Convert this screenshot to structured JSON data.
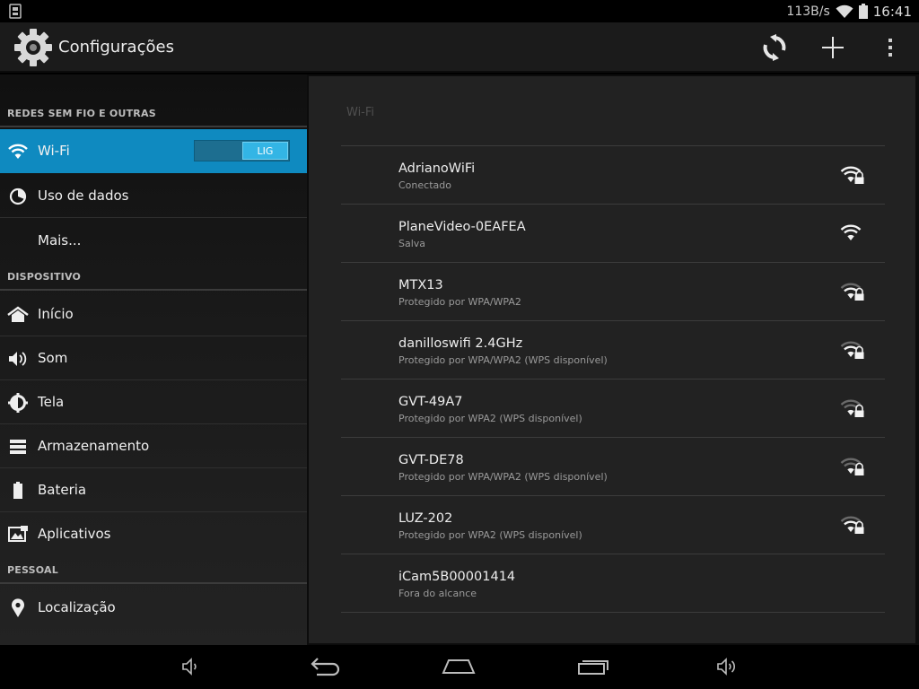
{
  "status_bar": {
    "speed": "113B/s",
    "time": "16:41"
  },
  "action_bar": {
    "title": "Configurações",
    "icons": [
      "gear-icon",
      "sync-icon",
      "add-icon",
      "overflow-menu-icon"
    ]
  },
  "sidebar": {
    "sections": [
      {
        "title": "REDES SEM FIO E OUTRAS"
      },
      {
        "title": "DISPOSITIVO"
      },
      {
        "title": "PESSOAL"
      }
    ],
    "items": [
      {
        "label": "Wi-Fi",
        "icon": "wifi-icon",
        "toggle": "LIG",
        "selected": true
      },
      {
        "label": "Uso de dados",
        "icon": "data-usage-icon"
      },
      {
        "label": "Mais...",
        "icon": ""
      },
      {
        "label": "Início",
        "icon": "home-icon"
      },
      {
        "label": "Som",
        "icon": "speaker-icon"
      },
      {
        "label": "Tela",
        "icon": "display-icon"
      },
      {
        "label": "Armazenamento",
        "icon": "storage-icon"
      },
      {
        "label": "Bateria",
        "icon": "battery-icon"
      },
      {
        "label": "Aplicativos",
        "icon": "apps-icon"
      },
      {
        "label": "Localização",
        "icon": "location-icon"
      }
    ]
  },
  "wifi_panel": {
    "title": "Wi-Fi",
    "networks": [
      {
        "name": "AdrianoWiFi",
        "status": "Conectado",
        "secured": true,
        "signal": "strong"
      },
      {
        "name": "PlaneVideo-0EAFEA",
        "status": "Salva",
        "secured": false,
        "signal": "strong"
      },
      {
        "name": "MTX13",
        "status": "Protegido por WPA/WPA2",
        "secured": true,
        "signal": "medium"
      },
      {
        "name": "danilloswifi 2.4GHz",
        "status": "Protegido por WPA/WPA2 (WPS disponível)",
        "secured": true,
        "signal": "medium"
      },
      {
        "name": "GVT-49A7",
        "status": "Protegido por WPA2 (WPS disponível)",
        "secured": true,
        "signal": "weak"
      },
      {
        "name": "GVT-DE78",
        "status": "Protegido por WPA/WPA2 (WPS disponível)",
        "secured": true,
        "signal": "weak"
      },
      {
        "name": "LUZ-202",
        "status": "Protegido por WPA2 (WPS disponível)",
        "secured": true,
        "signal": "medium"
      },
      {
        "name": "iCam5B00001414",
        "status": "Fora do alcance",
        "secured": false,
        "signal": "none"
      }
    ]
  },
  "nav_bar": {
    "icons": [
      "volume-down-icon",
      "back-icon",
      "home-nav-icon",
      "recent-apps-icon",
      "volume-up-icon"
    ]
  }
}
